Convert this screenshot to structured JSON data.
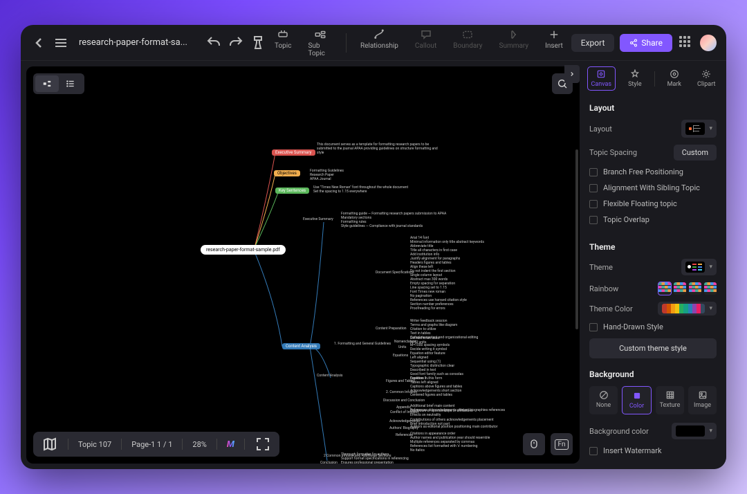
{
  "header": {
    "filename": "research-paper-format-sa...",
    "tools": [
      {
        "name": "topic",
        "label": "Topic",
        "disabled": false
      },
      {
        "name": "subtopic",
        "label": "Sub Topic",
        "disabled": false
      },
      {
        "name": "relationship",
        "label": "Relationship",
        "disabled": false
      },
      {
        "name": "callout",
        "label": "Callout",
        "disabled": true
      },
      {
        "name": "boundary",
        "label": "Boundary",
        "disabled": true
      },
      {
        "name": "summary",
        "label": "Summary",
        "disabled": true
      },
      {
        "name": "insert",
        "label": "Insert",
        "disabled": false
      }
    ],
    "export_label": "Export",
    "share_label": "Share"
  },
  "canvas": {
    "root_label": "research-paper-format-sample.pdf",
    "nodes": {
      "n1": "Executive Summary",
      "n2": "Objectives",
      "n3": "Key Sentences",
      "n4": "Content Analysis"
    },
    "topic_count": "Topic 107",
    "page": "Page-1  1 / 1",
    "zoom": "28%"
  },
  "side": {
    "tabs": [
      {
        "name": "canvas",
        "label": "Canvas",
        "active": true
      },
      {
        "name": "style",
        "label": "Style"
      },
      {
        "name": "mark",
        "label": "Mark"
      },
      {
        "name": "clipart",
        "label": "Clipart"
      }
    ],
    "layout": {
      "title": "Layout",
      "layout_label": "Layout",
      "spacing_label": "Topic Spacing",
      "spacing_btn": "Custom",
      "checks": [
        "Branch Free Positioning",
        "Alignment With Sibling Topic",
        "Flexible Floating topic",
        "Topic Overlap"
      ]
    },
    "theme": {
      "title": "Theme",
      "theme_label": "Theme",
      "rainbow_label": "Rainbow",
      "themecolor_label": "Theme Color",
      "handdrawn": "Hand-Drawn Style",
      "custom_btn": "Custom theme style",
      "colors": [
        "#c0392b",
        "#d35400",
        "#f39c12",
        "#f1c40f",
        "#27ae60",
        "#16a085",
        "#2980b9",
        "#8e44ad",
        "#e91e63",
        "#34495e"
      ]
    },
    "background": {
      "title": "Background",
      "options": [
        "None",
        "Color",
        "Texture",
        "Image"
      ],
      "bgcolor_label": "Background color",
      "watermark": "Insert Watermark"
    }
  }
}
